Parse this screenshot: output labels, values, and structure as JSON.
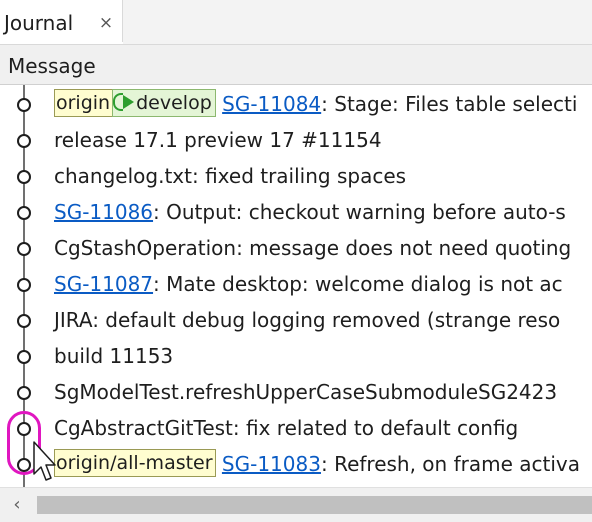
{
  "tab": {
    "title": "Journal",
    "close_glyph": "×"
  },
  "header": {
    "column_label": "Message"
  },
  "rows": [
    {
      "badges": [
        {
          "text": "origin",
          "style": "yellow"
        },
        {
          "text": "develop",
          "style": "green",
          "icon": "play-icon"
        }
      ],
      "link": "SG-11084",
      "text": ": Stage: Files table selecti"
    },
    {
      "text": "release 17.1 preview 17 #11154"
    },
    {
      "text": "changelog.txt: fixed trailing spaces"
    },
    {
      "link": "SG-11086",
      "text": ": Output: checkout warning before auto-s"
    },
    {
      "text": "CgStashOperation: message does not need quoting"
    },
    {
      "link": "SG-11087",
      "text": ": Mate desktop: welcome dialog is not ac"
    },
    {
      "text": "JIRA: default debug logging removed (strange reso"
    },
    {
      "text": "build 11153"
    },
    {
      "text": "SgModelTest.refreshUpperCaseSubmoduleSG2423"
    },
    {
      "text": "CgAbstractGitTest: fix related to default config"
    },
    {
      "badges": [
        {
          "text": "origin/all-master",
          "style": "yellow"
        }
      ],
      "link": "SG-11083",
      "text": ": Refresh, on frame activa"
    }
  ],
  "scrollbar": {
    "left_arrow": "‹"
  },
  "colors": {
    "link": "#0a5bc4",
    "highlight": "#e016c0",
    "branch_green": "#2e9e2e",
    "badge_yellow": "#fffdd0"
  }
}
